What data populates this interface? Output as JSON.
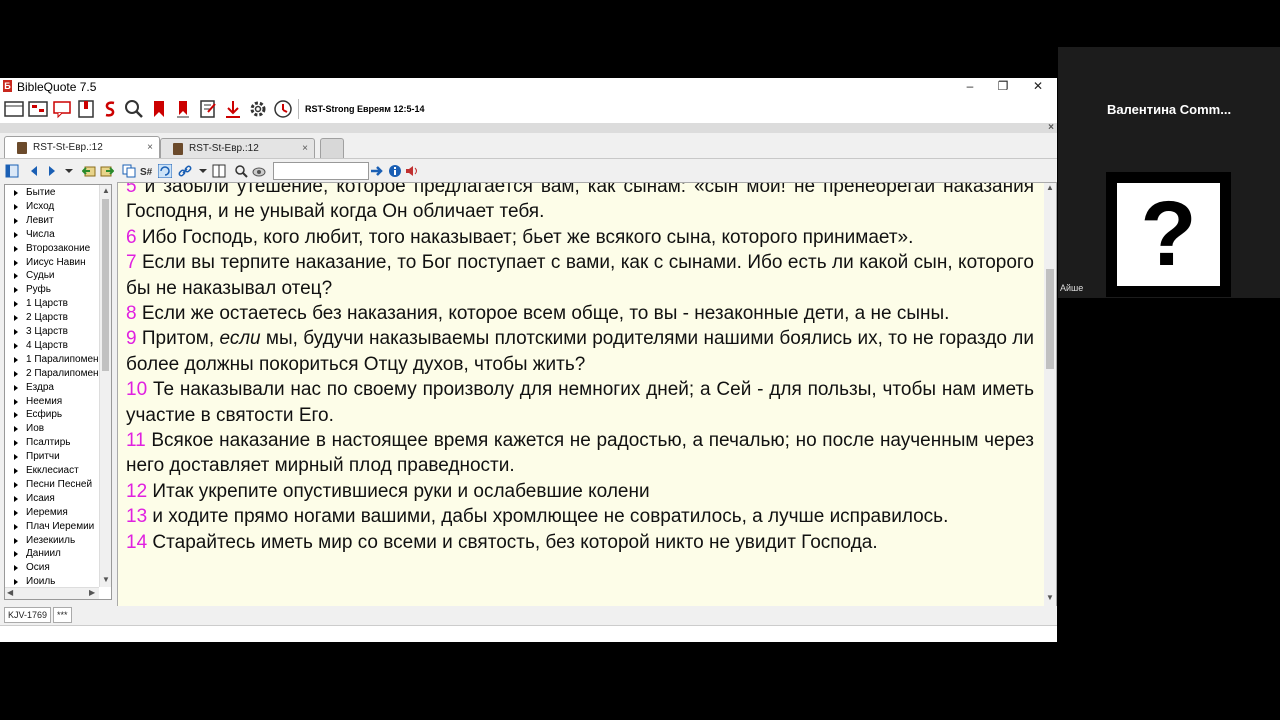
{
  "window": {
    "title": "BibleQuote 7.5",
    "app_icon": "Б",
    "controls": {
      "minimize": "–",
      "restore": "❐",
      "close": "✕"
    }
  },
  "toolbar": {
    "reference": "RST-Strong Евреям 12:5-14"
  },
  "strip": {
    "close": "×"
  },
  "tabs": [
    {
      "label": "RST-St-Евр.:12",
      "close": "×"
    },
    {
      "label": "RST-St-Евр.:12",
      "close": "×"
    }
  ],
  "books": [
    "Бытие",
    "Исход",
    "Левит",
    "Числа",
    "Второзаконие",
    "Иисус Навин",
    "Судьи",
    "Руфь",
    "1 Царств",
    "2 Царств",
    "3 Царств",
    "4 Царств",
    "1 Паралипоменон",
    "2 Паралипоменон",
    "Ездра",
    "Неемия",
    "Есфирь",
    "Иов",
    "Псалтирь",
    "Притчи",
    "Екклесиаст",
    "Песни Песней",
    "Исаия",
    "Иеремия",
    "Плач Иеремии",
    "Иезекииль",
    "Даниил",
    "Осия",
    "Иоиль"
  ],
  "verses": [
    {
      "num": "5",
      "text": " и забыли утешение, которое предлагается вам, как сынам: «сын мой! не пренебрегай наказания Господня, и не унывай когда Он обличает тебя."
    },
    {
      "num": "6",
      "text": " Ибо Господь, кого любит, того наказывает; бьет же всякого сына, которого принимает»."
    },
    {
      "num": "7",
      "text": " Если вы терпите наказание, то Бог поступает с вами, как с сынами. Ибо есть ли какой сын, которого бы не наказывал отец?"
    },
    {
      "num": "8",
      "text": " Если же остаетесь без наказания, которое всем обще, то вы - незаконные дети, а не сыны."
    },
    {
      "num": "9",
      "pre": " Притом, ",
      "em": "если",
      "text": " мы, будучи наказываемы плотскими родителями нашими боялись их, то не гораздо ли более должны покориться Отцу духов, чтобы жить?"
    },
    {
      "num": "10",
      "text": " Те наказывали нас по своему произволу для немногих дней; а Сей - для пользы, чтобы нам иметь участие в святости Его."
    },
    {
      "num": "11",
      "text": " Всякое наказание в настоящее время кажется не радостью, а печалью; но после наученным через него доставляет мирный плод праведности."
    },
    {
      "num": "12",
      "text": " Итак укрепите опустившиеся руки и ослабевшие колени"
    },
    {
      "num": "13",
      "text": " и ходите прямо ногами вашими, дабы хромлющее не совратилось, а лучше исправилось."
    },
    {
      "num": "14",
      "text": " Старайтесь иметь мир со всеми и святость, без которой никто не увидит Господа."
    }
  ],
  "status": {
    "module": "KJV-1769",
    "extra": "***"
  },
  "video": {
    "participant": "Валентина  Comm...",
    "avatar_symbol": "?",
    "tag": "Айше"
  },
  "colors": {
    "verse_number": "#e020e0",
    "content_bg": "#fdfde8"
  }
}
